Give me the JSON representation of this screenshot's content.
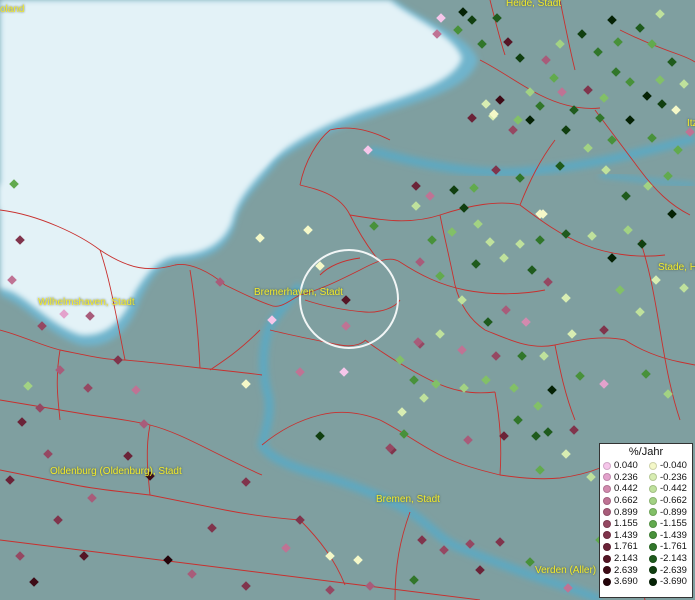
{
  "places": [
    {
      "name": "Heide, Stadt"
    },
    {
      "name": "Bremerhaven, Stadt"
    },
    {
      "name": "Wilhelmshaven, Stadt"
    },
    {
      "name": "Oldenburg (Oldenburg), Stadt"
    },
    {
      "name": "Bremen, Stadt"
    },
    {
      "name": "Verden (Aller)"
    },
    {
      "name": "Stade, H"
    },
    {
      "name": "oland"
    },
    {
      "name": "Itz"
    }
  ],
  "legend": {
    "title": "%/Jahr",
    "positive": [
      {
        "label": "0.040",
        "color": "#f6c6ea"
      },
      {
        "label": "0.236",
        "color": "#e3a2cc"
      },
      {
        "label": "0.442",
        "color": "#d28aae"
      },
      {
        "label": "0.662",
        "color": "#bf7394"
      },
      {
        "label": "0.899",
        "color": "#a85c7a"
      },
      {
        "label": "1.155",
        "color": "#954862"
      },
      {
        "label": "1.439",
        "color": "#80344c"
      },
      {
        "label": "1.761",
        "color": "#6b2338"
      },
      {
        "label": "2.143",
        "color": "#551525"
      },
      {
        "label": "2.639",
        "color": "#3e0b16"
      },
      {
        "label": "3.690",
        "color": "#24040a"
      }
    ],
    "negative": [
      {
        "label": "-0.040",
        "color": "#f4f8c8"
      },
      {
        "label": "-0.236",
        "color": "#d8edb2"
      },
      {
        "label": "-0.442",
        "color": "#bfe19c"
      },
      {
        "label": "-0.662",
        "color": "#a2d283"
      },
      {
        "label": "-0.899",
        "color": "#82c067"
      },
      {
        "label": "-1.155",
        "color": "#62aa4e"
      },
      {
        "label": "-1.439",
        "color": "#48913a"
      },
      {
        "label": "-1.761",
        "color": "#31762a"
      },
      {
        "label": "-2.143",
        "color": "#1f5b1d"
      },
      {
        "label": "-2.639",
        "color": "#113f10"
      },
      {
        "label": "-3.690",
        "color": "#052205"
      }
    ]
  },
  "colors": {
    "land": "#7f9fa0",
    "sea": "#e3f2f7",
    "border": "#c8302e",
    "water": "#5fa8c0",
    "label": "#f2ea2c"
  }
}
